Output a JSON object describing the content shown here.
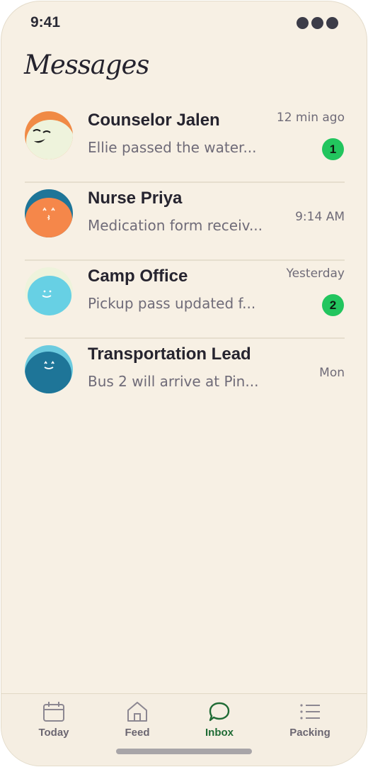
{
  "status": {
    "time": "9:41"
  },
  "page": {
    "title": "Messages"
  },
  "conversations": [
    {
      "name": "Counselor Jalen",
      "preview": "Ellie passed the water...",
      "time": "12 min ago",
      "unread": "1",
      "avatar_color": "#f08a45",
      "face_color": "#eef3dc"
    },
    {
      "name": "Nurse Priya",
      "preview": "Medication form receiv...",
      "time": "9:14 AM",
      "unread": "",
      "avatar_color": "#1e7598",
      "face_color": "#f5874a"
    },
    {
      "name": "Camp Office",
      "preview": "Pickup pass updated f...",
      "time": "Yesterday",
      "unread": "2",
      "avatar_color": "#eef3dc",
      "face_color": "#67d0e4"
    },
    {
      "name": "Transportation Lead",
      "preview": "Bus 2 will arrive at Pin...",
      "time": "Mon",
      "unread": "",
      "avatar_color": "#6ccbdf",
      "face_color": "#1e7598"
    }
  ],
  "tabs": [
    {
      "label": "Today",
      "icon": "calendar-icon"
    },
    {
      "label": "Feed",
      "icon": "home-icon"
    },
    {
      "label": "Inbox",
      "icon": "chat-bubble-icon",
      "active": true
    },
    {
      "label": "Packing",
      "icon": "list-icon"
    }
  ],
  "colors": {
    "background": "#f7f0e4",
    "accent": "#1f6b35",
    "badge": "#22c55e",
    "text": "#26242f",
    "muted": "#6f6b78"
  }
}
